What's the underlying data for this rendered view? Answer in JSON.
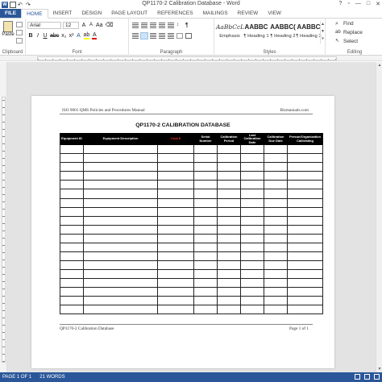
{
  "window": {
    "title": "QP1170-2 Calibration Database - Word",
    "controls": [
      "?",
      "▫",
      "—",
      "□",
      "✕"
    ]
  },
  "tabs": [
    "FILE",
    "HOME",
    "INSERT",
    "DESIGN",
    "PAGE LAYOUT",
    "REFERENCES",
    "MAILINGS",
    "REVIEW",
    "VIEW"
  ],
  "ribbon": {
    "clipboard": {
      "paste_label": "Paste",
      "group_label": "Clipboard"
    },
    "font": {
      "font_name": "Arial",
      "font_size": "12",
      "group_label": "Font"
    },
    "paragraph": {
      "group_label": "Paragraph"
    },
    "styles": {
      "group_label": "Styles",
      "items": [
        {
          "sample": "AaBbCcL",
          "name": "Emphasis"
        },
        {
          "sample": "AABBC",
          "name": "¶ Heading 1"
        },
        {
          "sample": "AABBC(",
          "name": "¶ Heading 2"
        },
        {
          "sample": "AABBC",
          "name": "¶ Heading 3"
        }
      ]
    },
    "editing": {
      "group_label": "Editing",
      "find": "Find",
      "replace": "Replace",
      "select": "Select"
    }
  },
  "document": {
    "header_left": "ISO 9001 QMS Policies and Procedures Manual",
    "header_right": "Bizmanuals.com",
    "title": "QP1170-2 CALIBRATION DATABASE",
    "columns": [
      "Equipment ID",
      "Equipment Description",
      "Cost $",
      "Serial Number",
      "Calibration Period",
      "Last Calibration Date",
      "Calibration Due Date",
      "Person/Organization Calibrating"
    ],
    "empty_rows": 19,
    "footer_left": "QP1170-2 Calibration Database",
    "footer_right": "Page 1 of 1"
  },
  "status": {
    "page": "PAGE 1 OF 1",
    "words": "21 WORDS"
  },
  "colors": {
    "accent": "#2b579a",
    "table_header_bg": "#000000",
    "cost_header_text": "#ff2a2a"
  }
}
